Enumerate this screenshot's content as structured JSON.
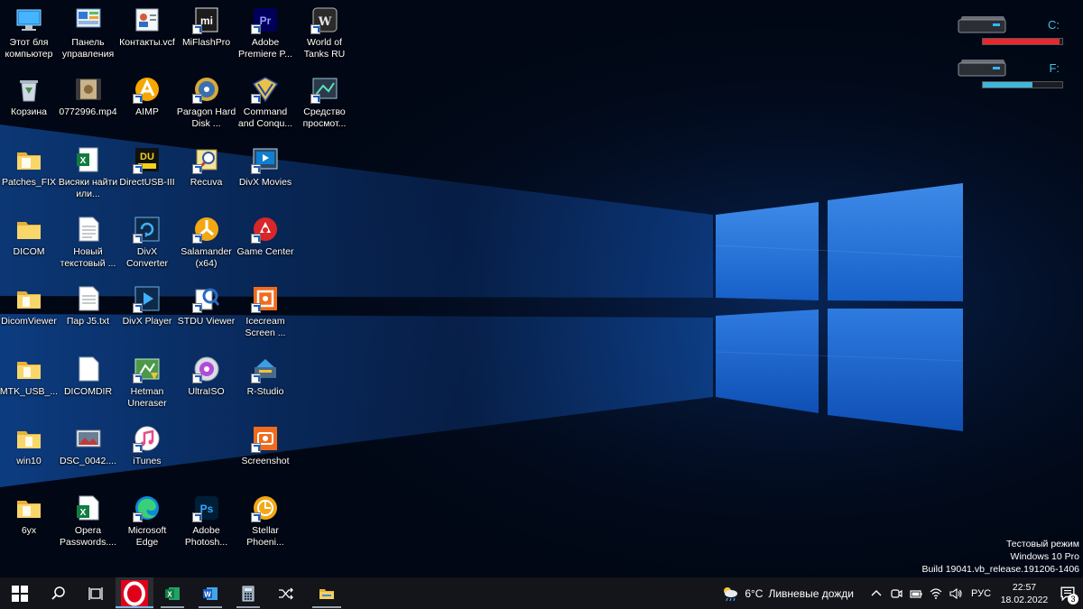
{
  "desktop_icons": [
    {
      "id": "this-pc",
      "label": "Этот бля компьютер",
      "shortcut": false
    },
    {
      "id": "control-panel",
      "label": "Панель управления",
      "shortcut": false
    },
    {
      "id": "contacts",
      "label": "Контакты.vcf",
      "shortcut": false
    },
    {
      "id": "miflashpro",
      "label": "MiFlashPro",
      "shortcut": true
    },
    {
      "id": "premiere",
      "label": "Adobe Premiere P...",
      "shortcut": true
    },
    {
      "id": "wot",
      "label": "World of Tanks RU",
      "shortcut": true
    },
    {
      "id": "recycle-bin",
      "label": "Корзина",
      "shortcut": false
    },
    {
      "id": "mp4",
      "label": "0772996.mp4",
      "shortcut": false
    },
    {
      "id": "aimp",
      "label": "AIMP",
      "shortcut": true
    },
    {
      "id": "paragon",
      "label": "Paragon Hard Disk ...",
      "shortcut": true
    },
    {
      "id": "cnc",
      "label": "Command and Conqu...",
      "shortcut": true
    },
    {
      "id": "viewer",
      "label": "Средство просмот...",
      "shortcut": true
    },
    {
      "id": "patches",
      "label": "Patches_FIX",
      "shortcut": false
    },
    {
      "id": "xls",
      "label": "Висяки найти или...",
      "shortcut": false
    },
    {
      "id": "directusb",
      "label": "DirectUSB-III",
      "shortcut": true
    },
    {
      "id": "recuva",
      "label": "Recuva",
      "shortcut": true
    },
    {
      "id": "divx-movies",
      "label": "DivX Movies",
      "shortcut": true
    },
    {
      "id": "dicom",
      "label": "DICOM",
      "shortcut": false
    },
    {
      "id": "newtxt",
      "label": "Новый текстовый ...",
      "shortcut": false
    },
    {
      "id": "divx-conv",
      "label": "DivX Converter",
      "shortcut": true
    },
    {
      "id": "salamander",
      "label": "Salamander (x64)",
      "shortcut": true
    },
    {
      "id": "gamecenter",
      "label": "Game Center",
      "shortcut": true
    },
    {
      "id": "dicomviewer",
      "label": "DicomViewer",
      "shortcut": false
    },
    {
      "id": "parj5",
      "label": "Пар J5.txt",
      "shortcut": false
    },
    {
      "id": "divx-player",
      "label": "DivX Player",
      "shortcut": true
    },
    {
      "id": "stdu",
      "label": "STDU Viewer",
      "shortcut": true
    },
    {
      "id": "icecream",
      "label": "Icecream Screen ...",
      "shortcut": true
    },
    {
      "id": "mtkusb",
      "label": "MTK_USB_...",
      "shortcut": false
    },
    {
      "id": "dicomdir",
      "label": "DICOMDIR",
      "shortcut": false
    },
    {
      "id": "hetman",
      "label": "Hetman Uneraser",
      "shortcut": true
    },
    {
      "id": "ultraiso",
      "label": "UltraISO",
      "shortcut": true
    },
    {
      "id": "rstudio",
      "label": "R-Studio",
      "shortcut": true
    },
    {
      "id": "win10",
      "label": "win10",
      "shortcut": false
    },
    {
      "id": "dsc",
      "label": "DSC_0042....",
      "shortcut": false
    },
    {
      "id": "itunes",
      "label": "iTunes",
      "shortcut": true
    },
    {
      "id": "screenshot",
      "label": "Screenshot",
      "shortcut": true
    },
    {
      "id": "6yx",
      "label": "6ух",
      "shortcut": false
    },
    {
      "id": "opera-pw",
      "label": "Opera Passwords....",
      "shortcut": false
    },
    {
      "id": "edge",
      "label": "Microsoft Edge",
      "shortcut": true
    },
    {
      "id": "photoshop",
      "label": "Adobe Photosh...",
      "shortcut": true
    },
    {
      "id": "stellar",
      "label": "Stellar Phoeni...",
      "shortcut": true
    }
  ],
  "drives": [
    {
      "letter": "C:",
      "usage": 0.97,
      "color": "#e8282f"
    },
    {
      "letter": "F:",
      "usage": 0.62,
      "color": "#3fb6dc"
    }
  ],
  "watermark": {
    "line1": "Тестовый режим",
    "line2": "Windows 10 Pro",
    "line3": "Build 19041.vb_release.191206-1406"
  },
  "taskbar": {
    "start_label": "Start",
    "apps": [
      "search",
      "task-view",
      "opera",
      "excel",
      "word",
      "calculator",
      "switch",
      "file-explorer"
    ],
    "weather": {
      "temp": "6°C",
      "desc": "Ливневые дожди"
    },
    "language": "РУС",
    "time": "22:57",
    "date": "18.02.2022",
    "notifications": "3"
  },
  "colors": {
    "taskbar_bg": "#13151a",
    "desktop_bg": "#010714",
    "accent": "#1a74d6"
  }
}
